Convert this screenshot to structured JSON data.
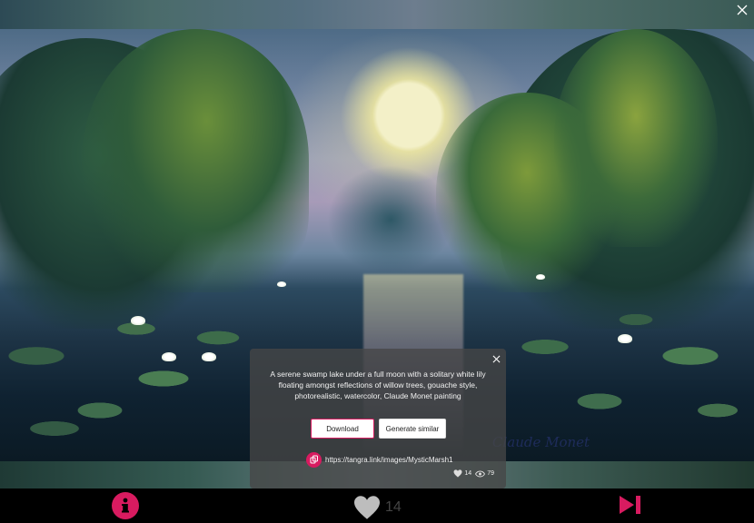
{
  "viewer": {
    "close_icon": "close-icon"
  },
  "artwork": {
    "signature": "Claude Monet"
  },
  "info_panel": {
    "prompt": "A serene swamp lake under a full moon with a solitary white lily floating amongst reflections of willow trees, gouache style, photorealistic, watercolor, Claude Monet painting",
    "download_label": "Download",
    "generate_similar_label": "Generate similar",
    "link": "https://tangra.link/images/MysticMarsh1",
    "likes": "14",
    "views": "79"
  },
  "bottom_bar": {
    "like_count": "14"
  },
  "colors": {
    "accent": "#d81b60"
  }
}
